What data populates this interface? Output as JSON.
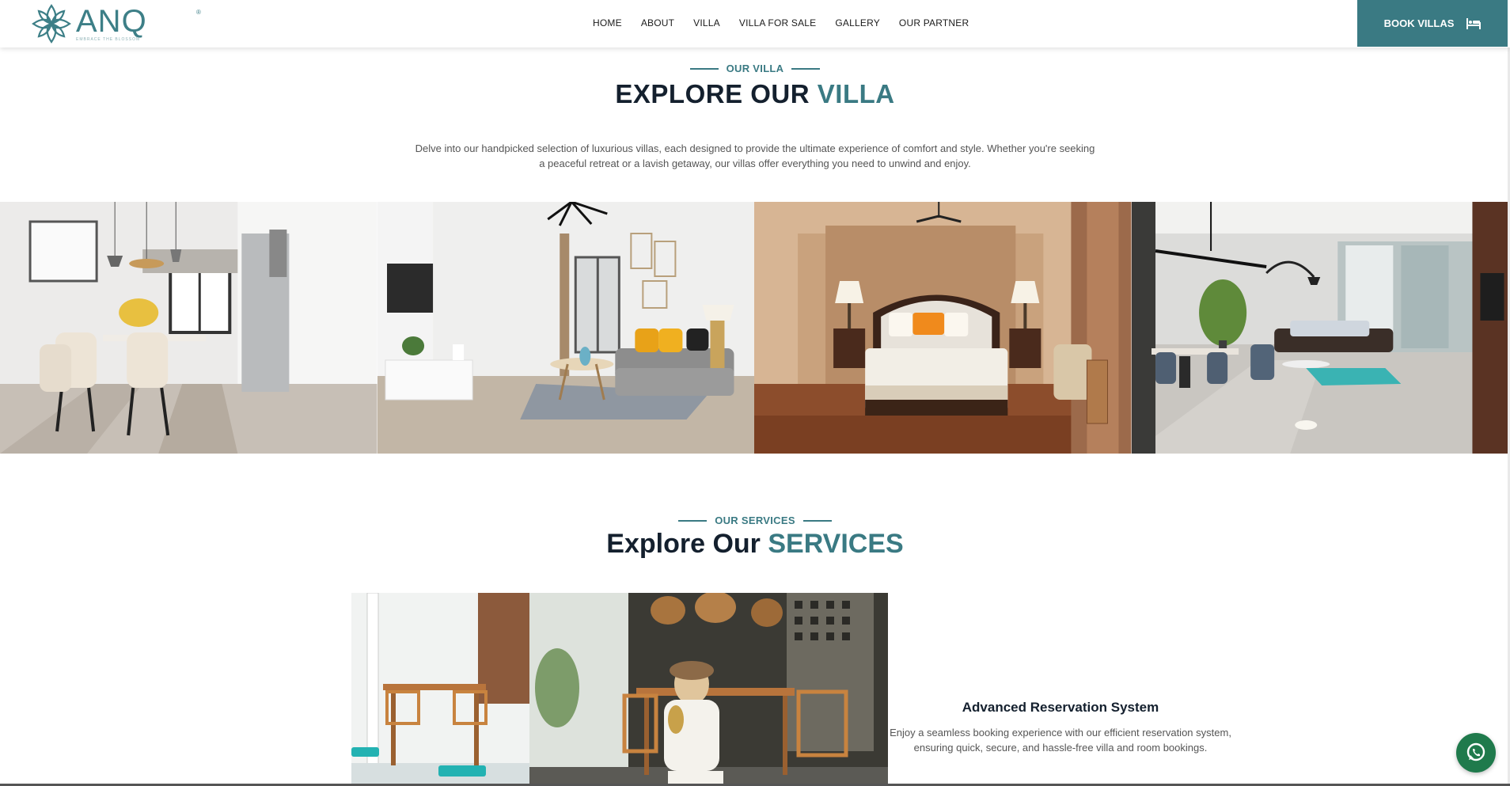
{
  "brand": {
    "name": "ANQ",
    "registered": "®",
    "tagline": "EMBRACE THE BLOSSOM"
  },
  "nav": {
    "items": [
      "HOME",
      "ABOUT",
      "VILLA",
      "VILLA FOR SALE",
      "GALLERY",
      "OUR PARTNER"
    ]
  },
  "header": {
    "book_label": "BOOK VILLAS",
    "book_icon": "bed-icon"
  },
  "villa_section": {
    "eyebrow": "OUR VILLA",
    "heading_main": "EXPLORE OUR",
    "heading_accent": "VILLA",
    "description": "Delve into our handpicked selection of luxurious villas, each designed to provide the ultimate experience of comfort and style. Whether you're seeking a peaceful retreat or a lavish getaway, our villas offer everything you need to unwind and enjoy."
  },
  "services_section": {
    "eyebrow": "OUR SERVICES",
    "heading_main": "Explore Our",
    "heading_accent": "SERVICES",
    "service_title": "Advanced Reservation System",
    "service_description": "Enjoy a seamless booking experience with our efficient reservation system, ensuring quick, secure, and hassle-free villa and room bookings."
  },
  "floating": {
    "whatsapp_icon": "whatsapp-icon"
  },
  "colors": {
    "accent": "#3a7a83",
    "heading": "#14202e",
    "whatsapp": "#1f7a4c"
  }
}
